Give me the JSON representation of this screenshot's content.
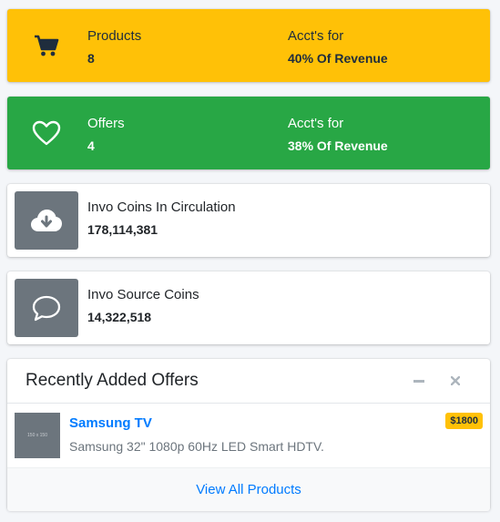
{
  "products_card": {
    "label": "Products",
    "count": "8",
    "acct_label": "Acct's for",
    "acct_value": "40% Of Revenue",
    "icon": "shopping-cart-icon",
    "color": "#ffc107"
  },
  "offers_card": {
    "label": "Offers",
    "count": "4",
    "acct_label": "Acct's for",
    "acct_value": "38% Of Revenue",
    "icon": "heart-icon",
    "color": "#28a745"
  },
  "coins_circulation": {
    "label": "Invo Coins In Circulation",
    "value": "178,114,381",
    "icon": "cloud-download-icon"
  },
  "source_coins": {
    "label": "Invo Source Coins",
    "value": "14,322,518",
    "icon": "comment-icon"
  },
  "recent_offers": {
    "title": "Recently Added Offers",
    "items": [
      {
        "thumb_text": "150 x 150",
        "name": "Samsung TV",
        "description": "Samsung 32\" 1080p 60Hz LED Smart HDTV.",
        "price": "$1800"
      }
    ],
    "footer_link": "View All Products"
  }
}
